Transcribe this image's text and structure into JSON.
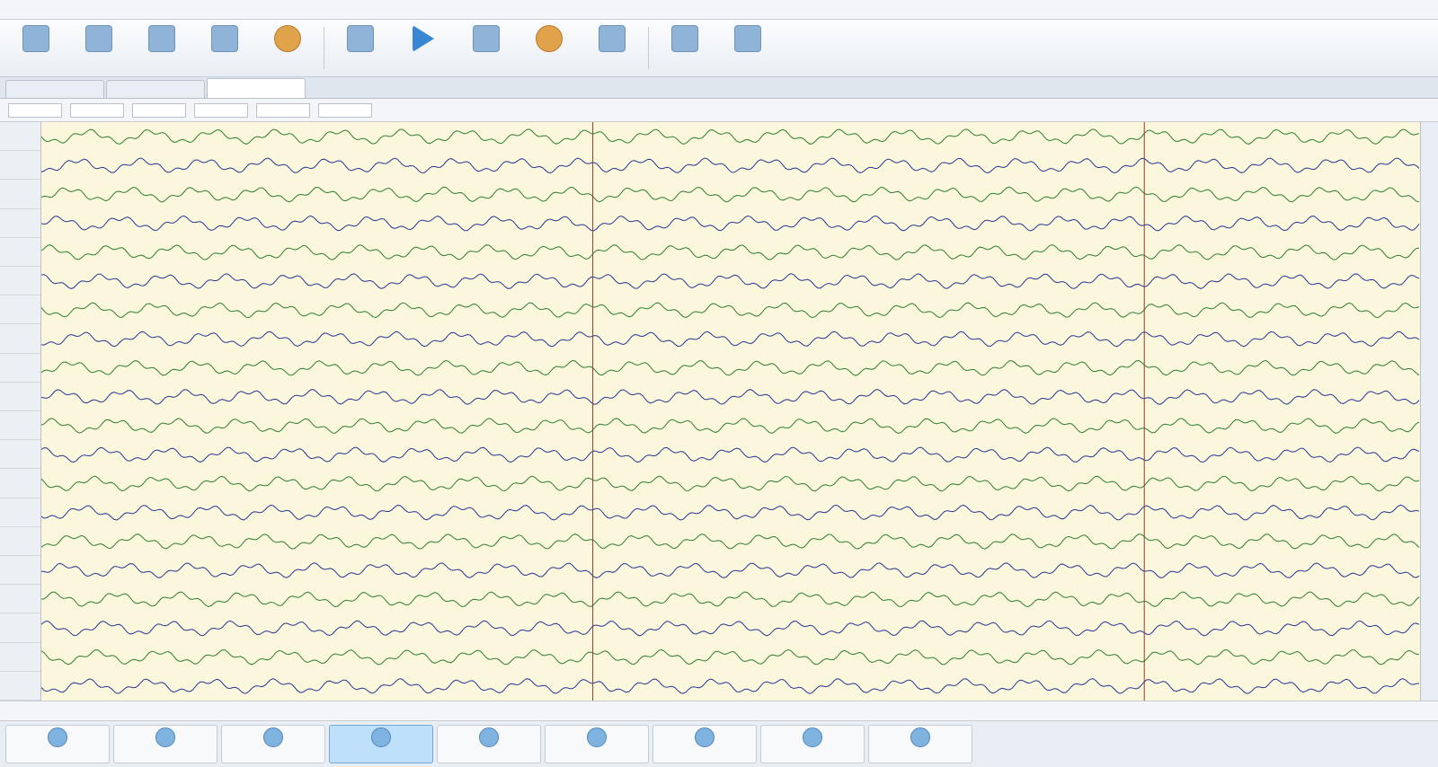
{
  "menu": [
    "",
    "",
    "",
    "",
    "",
    "",
    "",
    "",
    ""
  ],
  "toolbar": {
    "tools": [
      {
        "label": ""
      },
      {
        "label": ""
      },
      {
        "label": ""
      },
      {
        "label": ""
      },
      {
        "label": ""
      },
      {
        "label": ""
      },
      {
        "label": ""
      },
      {
        "label": ""
      },
      {
        "label": ""
      },
      {
        "label": ""
      },
      {
        "label": ""
      },
      {
        "label": ""
      }
    ]
  },
  "tabs": [
    {
      "label": ""
    },
    {
      "label": ""
    },
    {
      "label": ""
    }
  ],
  "params": [
    {
      "label": "",
      "value": ""
    },
    {
      "label": "",
      "value": ""
    },
    {
      "label": "",
      "value": ""
    },
    {
      "label": "",
      "value": ""
    },
    {
      "label": "",
      "value": ""
    },
    {
      "label": "",
      "value": ""
    }
  ],
  "channels": [
    "",
    "",
    "",
    "",
    "",
    "",
    "",
    "",
    "",
    "",
    "",
    "",
    "",
    "",
    "",
    "",
    "",
    "",
    "",
    ""
  ],
  "markers": [
    {
      "label": ""
    },
    {
      "label": ""
    }
  ],
  "side_panel": {
    "label": ""
  },
  "status": [
    "",
    "",
    "",
    "",
    ""
  ],
  "functions": [
    {
      "label": ""
    },
    {
      "label": ""
    },
    {
      "label": ""
    },
    {
      "label": ""
    },
    {
      "label": ""
    },
    {
      "label": ""
    },
    {
      "label": ""
    },
    {
      "label": ""
    },
    {
      "label": ""
    }
  ],
  "colors": {
    "trace_a": "#2e7d32",
    "trace_b": "#283593",
    "marker": "#8d3b2b",
    "plot_bg": "#fbf7dc"
  }
}
